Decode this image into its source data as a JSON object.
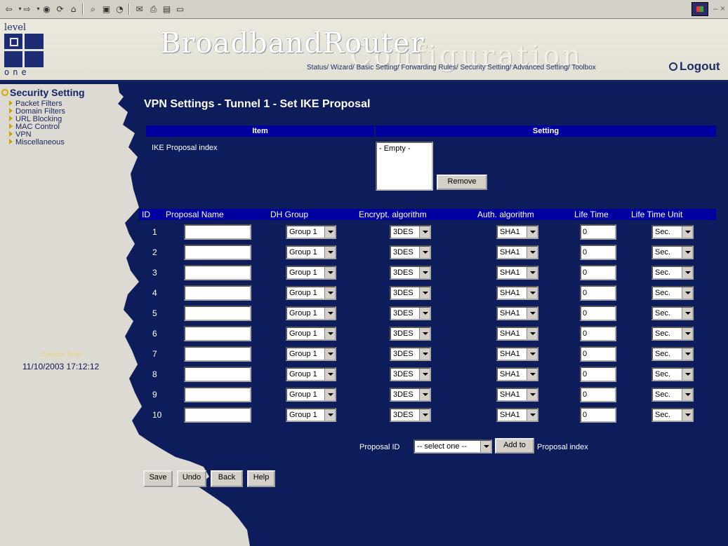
{
  "browser": {
    "toolbar_icons": [
      "back-icon",
      "forward-icon",
      "stop-icon",
      "refresh-icon",
      "home-icon",
      "search-icon",
      "favorites-icon",
      "history-icon",
      "mail-icon",
      "print-icon",
      "edit-icon",
      "discuss-icon"
    ],
    "window_controls": "– ×"
  },
  "header": {
    "logo_top": "level",
    "logo_bottom": "one",
    "brand": "BroadbandRouter",
    "brand_sub": "Configuration",
    "nav": [
      "Status/",
      "Wizard/",
      "Basic Setting/",
      "Forwarding Rules/",
      "Security Setting/",
      "Advanced Setting/",
      "Toolbox"
    ],
    "logout": "Logout"
  },
  "sidebar": {
    "title": "Security Setting",
    "items": [
      "Packet Filters",
      "Domain Filters",
      "URL Blocking",
      "MAC Control",
      "VPN",
      "Miscellaneous"
    ],
    "current_time_label": "Current Time",
    "current_time_value": "11/10/2003 17:12:12"
  },
  "main": {
    "title": "VPN Settings - Tunnel 1 - Set IKE Proposal",
    "item_header": "Item",
    "setting_header": "Setting",
    "ike_label": "IKE Proposal index",
    "listbox_value": "- Empty -",
    "remove_label": "Remove",
    "columns": [
      "ID",
      "Proposal Name",
      "DH Group",
      "Encrypt. algorithm",
      "Auth. algorithm",
      "Life Time",
      "Life Time Unit"
    ],
    "rows": [
      {
        "id": "1",
        "name": "",
        "dh": "Group 1",
        "enc": "3DES",
        "auth": "SHA1",
        "life": "0",
        "unit": "Sec."
      },
      {
        "id": "2",
        "name": "",
        "dh": "Group 1",
        "enc": "3DES",
        "auth": "SHA1",
        "life": "0",
        "unit": "Sec."
      },
      {
        "id": "3",
        "name": "",
        "dh": "Group 1",
        "enc": "3DES",
        "auth": "SHA1",
        "life": "0",
        "unit": "Sec."
      },
      {
        "id": "4",
        "name": "",
        "dh": "Group 1",
        "enc": "3DES",
        "auth": "SHA1",
        "life": "0",
        "unit": "Sec."
      },
      {
        "id": "5",
        "name": "",
        "dh": "Group 1",
        "enc": "3DES",
        "auth": "SHA1",
        "life": "0",
        "unit": "Sec."
      },
      {
        "id": "6",
        "name": "",
        "dh": "Group 1",
        "enc": "3DES",
        "auth": "SHA1",
        "life": "0",
        "unit": "Sec."
      },
      {
        "id": "7",
        "name": "",
        "dh": "Group 1",
        "enc": "3DES",
        "auth": "SHA1",
        "life": "0",
        "unit": "Sec."
      },
      {
        "id": "8",
        "name": "",
        "dh": "Group 1",
        "enc": "3DES",
        "auth": "SHA1",
        "life": "0",
        "unit": "Sec."
      },
      {
        "id": "9",
        "name": "",
        "dh": "Group 1",
        "enc": "3DES",
        "auth": "SHA1",
        "life": "0",
        "unit": "Sec."
      },
      {
        "id": "10",
        "name": "",
        "dh": "Group 1",
        "enc": "3DES",
        "auth": "SHA1",
        "life": "0",
        "unit": "Sec."
      }
    ],
    "proposal_id_label": "Proposal ID",
    "proposal_select": "-- select one --",
    "add_to_label": "Add to",
    "proposal_index_label": "Proposal index"
  },
  "actions": [
    "Save",
    "Undo",
    "Back",
    "Help"
  ],
  "colors": {
    "main_bg": "#0d1d5c",
    "header_bar": "#0000a0",
    "sidebar_bg": "#dcdad2",
    "time_label": "#e8d478"
  }
}
